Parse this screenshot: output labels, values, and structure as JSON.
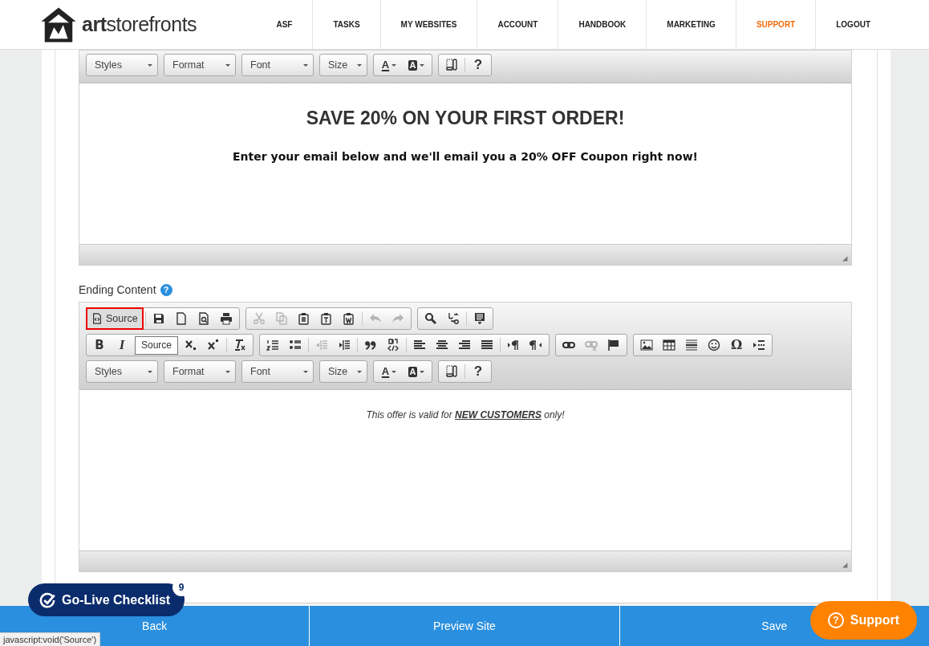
{
  "header": {
    "logo": "**art**storefronts",
    "nav": [
      {
        "label": "ASF",
        "selected": false
      },
      {
        "label": "TASKS",
        "selected": false
      },
      {
        "label": "MY WEBSITES",
        "selected": false
      },
      {
        "label": "ACCOUNT",
        "selected": false
      },
      {
        "label": "HANDBOOK",
        "selected": false
      },
      {
        "label": "MARKETING",
        "selected": false
      },
      {
        "label": "SUPPORT",
        "selected": true
      },
      {
        "label": "LOGOUT",
        "selected": false
      }
    ]
  },
  "top_editor": {
    "toolbar": [
      [
        [
          {
            "kind": "combo",
            "text": "Styles"
          }
        ],
        [
          {
            "kind": "combo",
            "text": "Format"
          }
        ],
        [
          {
            "kind": "combo",
            "text": "Font"
          }
        ],
        [
          {
            "kind": "combo",
            "text": "Size"
          }
        ],
        [
          {
            "kind": "text-color",
            "text": "A",
            "disabled": false
          },
          {
            "kind": "bg-color",
            "text": "A",
            "disabled": false
          }
        ],
        [
          {
            "kind": "maximize",
            "disabled": false
          },
          {
            "kind": "separator"
          },
          {
            "kind": "about",
            "text": "?",
            "disabled": false
          }
        ]
      ]
    ],
    "heading": "SAVE 20% ON YOUR FIRST ORDER!",
    "subheading": "Enter your email below and we'll email you a 20% OFF Coupon right now!"
  },
  "ending_editor": {
    "label": "Ending Content",
    "help": "?",
    "toolbar": [
      [
        [
          {
            "kind": "source",
            "text": "Source",
            "focused": true
          },
          {
            "kind": "separator"
          },
          {
            "kind": "save",
            "disabled": false
          },
          {
            "kind": "new-page",
            "disabled": false
          },
          {
            "kind": "preview",
            "disabled": false
          },
          {
            "kind": "print",
            "disabled": false
          }
        ],
        [
          {
            "kind": "cut",
            "disabled": true
          },
          {
            "kind": "copy",
            "disabled": true
          },
          {
            "kind": "paste",
            "disabled": false
          },
          {
            "kind": "paste-text",
            "disabled": false
          },
          {
            "kind": "paste-word",
            "disabled": false
          },
          {
            "kind": "separator"
          },
          {
            "kind": "undo",
            "disabled": true
          },
          {
            "kind": "redo",
            "disabled": true
          }
        ],
        [
          {
            "kind": "find",
            "disabled": false
          },
          {
            "kind": "replace",
            "disabled": false
          },
          {
            "kind": "separator"
          },
          {
            "kind": "select-all",
            "disabled": false
          }
        ]
      ],
      [
        [
          {
            "kind": "bold",
            "text": "B",
            "disabled": false
          },
          {
            "kind": "italic",
            "text": "I",
            "disabled": false
          },
          {
            "kind": "tooltip",
            "text": "Source"
          },
          {
            "kind": "subscript",
            "disabled": false
          },
          {
            "kind": "superscript",
            "disabled": false
          },
          {
            "kind": "separator"
          },
          {
            "kind": "remove-format",
            "disabled": false
          }
        ],
        [
          {
            "kind": "numbered-list",
            "disabled": false
          },
          {
            "kind": "bulleted-list",
            "disabled": false
          },
          {
            "kind": "separator"
          },
          {
            "kind": "outdent",
            "disabled": true
          },
          {
            "kind": "indent",
            "disabled": false
          },
          {
            "kind": "separator"
          },
          {
            "kind": "blockquote",
            "disabled": false
          },
          {
            "kind": "div",
            "disabled": false
          },
          {
            "kind": "separator"
          },
          {
            "kind": "align-left",
            "disabled": false
          },
          {
            "kind": "align-center",
            "disabled": false
          },
          {
            "kind": "align-right",
            "disabled": false
          },
          {
            "kind": "justify",
            "disabled": false
          },
          {
            "kind": "separator"
          },
          {
            "kind": "ltr",
            "disabled": false
          },
          {
            "kind": "rtl",
            "disabled": false
          }
        ],
        [
          {
            "kind": "link",
            "disabled": false
          },
          {
            "kind": "unlink",
            "disabled": true
          },
          {
            "kind": "anchor",
            "disabled": false
          }
        ],
        [
          {
            "kind": "image",
            "disabled": false
          },
          {
            "kind": "table",
            "disabled": false
          },
          {
            "kind": "horizontal-line",
            "disabled": false
          },
          {
            "kind": "smiley",
            "disabled": false
          },
          {
            "kind": "special-char",
            "text": "Ω",
            "disabled": false
          },
          {
            "kind": "page-break",
            "disabled": false
          }
        ]
      ],
      [
        [
          {
            "kind": "combo",
            "text": "Styles"
          }
        ],
        [
          {
            "kind": "combo",
            "text": "Format"
          }
        ],
        [
          {
            "kind": "combo",
            "text": "Font"
          }
        ],
        [
          {
            "kind": "combo",
            "text": "Size"
          }
        ],
        [
          {
            "kind": "text-color",
            "text": "A",
            "disabled": false
          },
          {
            "kind": "bg-color",
            "text": "A",
            "disabled": false
          }
        ],
        [
          {
            "kind": "maximize",
            "disabled": false
          },
          {
            "kind": "separator"
          },
          {
            "kind": "about",
            "text": "?",
            "disabled": false
          }
        ]
      ]
    ],
    "content": "This offer is valid for **NEW CUSTOMERS** only!"
  },
  "footer": {
    "buttons": [
      "Back",
      "Preview Site",
      "Save"
    ]
  },
  "checklist": {
    "label": "Go-Live Checklist",
    "count": "9"
  },
  "support": {
    "icon": "?",
    "label": "Support"
  },
  "status_bar": "javascript:void('Source')"
}
